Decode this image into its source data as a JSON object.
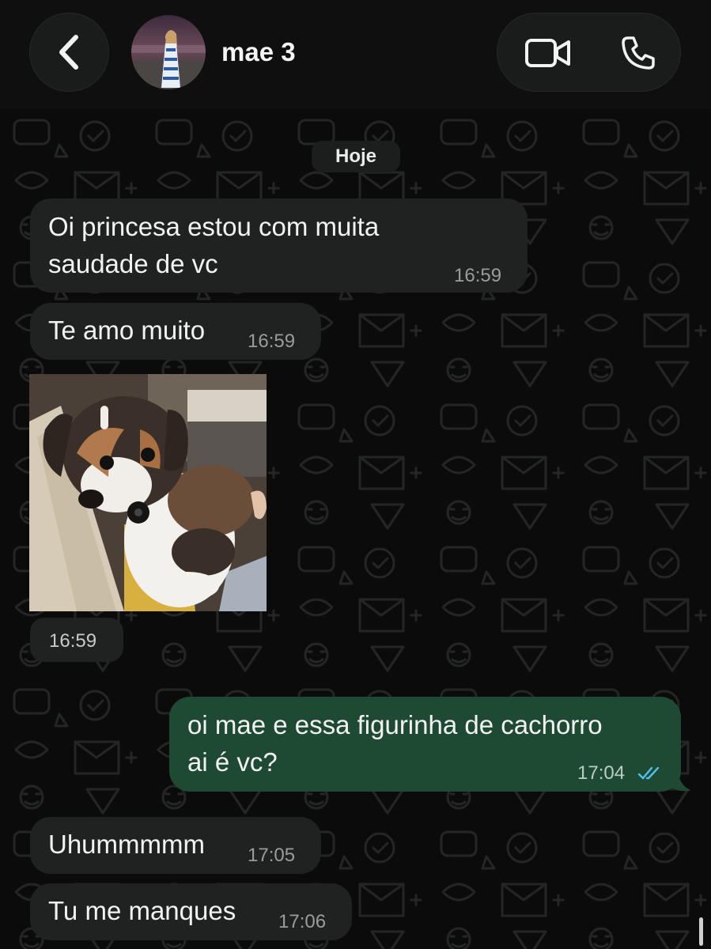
{
  "header": {
    "contact_name": "mae 3"
  },
  "chat": {
    "date_label": "Hoje",
    "messages": [
      {
        "direction": "incoming",
        "line1": "Oi princesa estou com muita",
        "line2": "saudade de vc",
        "time": "16:59"
      },
      {
        "direction": "incoming",
        "text": "Te amo muito",
        "time": "16:59"
      },
      {
        "direction": "incoming",
        "type": "image",
        "time": "16:59"
      },
      {
        "direction": "outgoing",
        "line1": "oi mae e essa figurinha de cachorro",
        "line2": "ai é vc?",
        "time": "17:04",
        "status": "read"
      },
      {
        "direction": "incoming",
        "text": "Uhummmmm",
        "time": "17:05"
      },
      {
        "direction": "incoming",
        "text": "Tu me manques",
        "time": "17:06"
      }
    ]
  },
  "icons": {
    "back": "chevron-left-icon",
    "video": "video-camera-icon",
    "phone": "phone-icon",
    "read_receipt": "double-check-icon"
  },
  "colors": {
    "background": "#0b0b0b",
    "incoming_bubble": "#202221",
    "outgoing_bubble": "#1e4a33",
    "read_check": "#53bdeb"
  }
}
